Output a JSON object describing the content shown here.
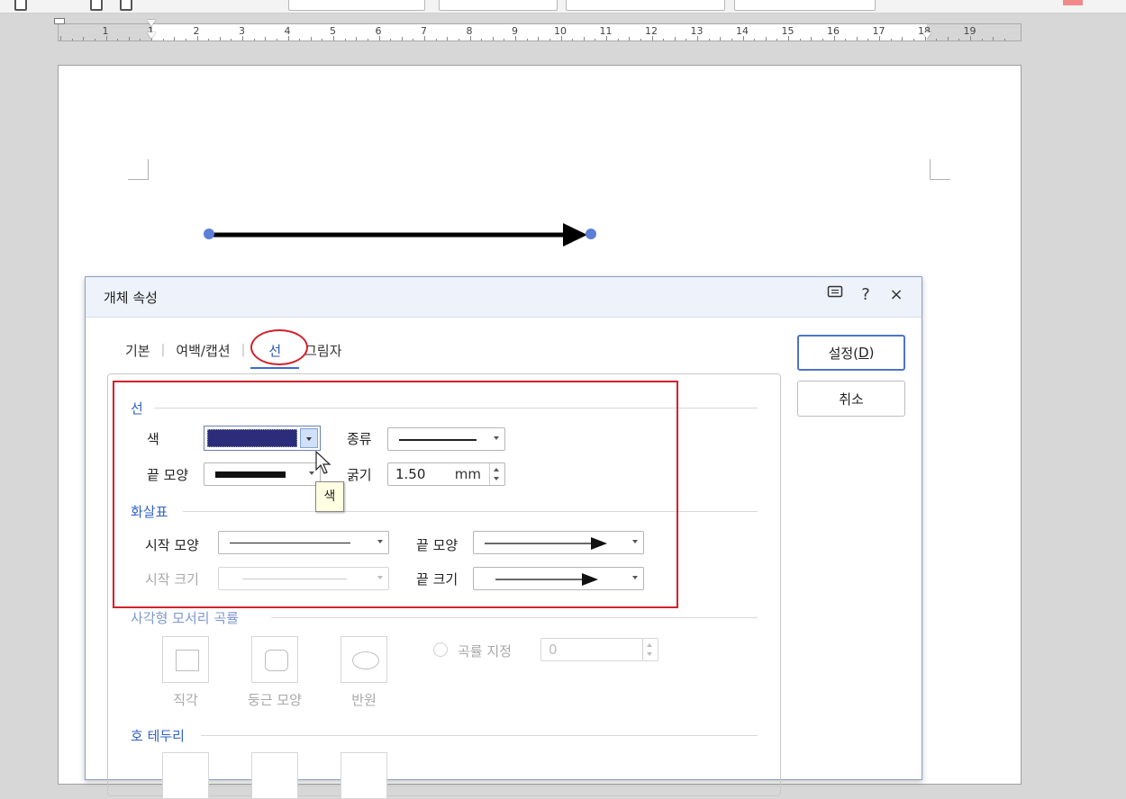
{
  "ruler": {
    "numbers": [
      "1",
      "1",
      "2",
      "3",
      "4",
      "5",
      "6",
      "7",
      "8",
      "9",
      "10",
      "11",
      "12",
      "13",
      "14",
      "15",
      "16",
      "17",
      "18",
      "19"
    ]
  },
  "dialog": {
    "title": "개체 속성",
    "title_icons": {
      "chat": "comment-icon",
      "help": "?",
      "close": "×"
    },
    "tabs": [
      {
        "label": "기본",
        "active": false
      },
      {
        "label": "여백/캡션",
        "active": false
      },
      {
        "label": "선",
        "active": true
      },
      {
        "label": "그림자",
        "active": false
      }
    ],
    "buttons": {
      "ok_label": "설정(",
      "ok_key": "D",
      "ok_tail": ")",
      "cancel_label": "취소"
    },
    "line_section": {
      "title": "선",
      "color_label": "색",
      "color_value": "#2b2d7a",
      "type_label": "종류",
      "cap_label": "끝 모양",
      "width_label": "굵기",
      "width_value": "1.50",
      "width_unit": "mm",
      "tooltip": "색"
    },
    "arrow_section": {
      "title": "화살표",
      "start_shape_label": "시작 모양",
      "end_shape_label": "끝 모양",
      "start_size_label": "시작 크기",
      "end_size_label": "끝 크기"
    },
    "corner_section": {
      "title": "사각형 모서리 곡률",
      "options": [
        "직각",
        "둥근 모양",
        "반원"
      ],
      "custom_label": "곡률 지정",
      "custom_value": "0"
    },
    "arc_section": {
      "title": "호 테두리"
    }
  },
  "colors": {
    "accent": "#3262c2",
    "highlight": "#d4202a",
    "handle": "#5b7fd6"
  }
}
